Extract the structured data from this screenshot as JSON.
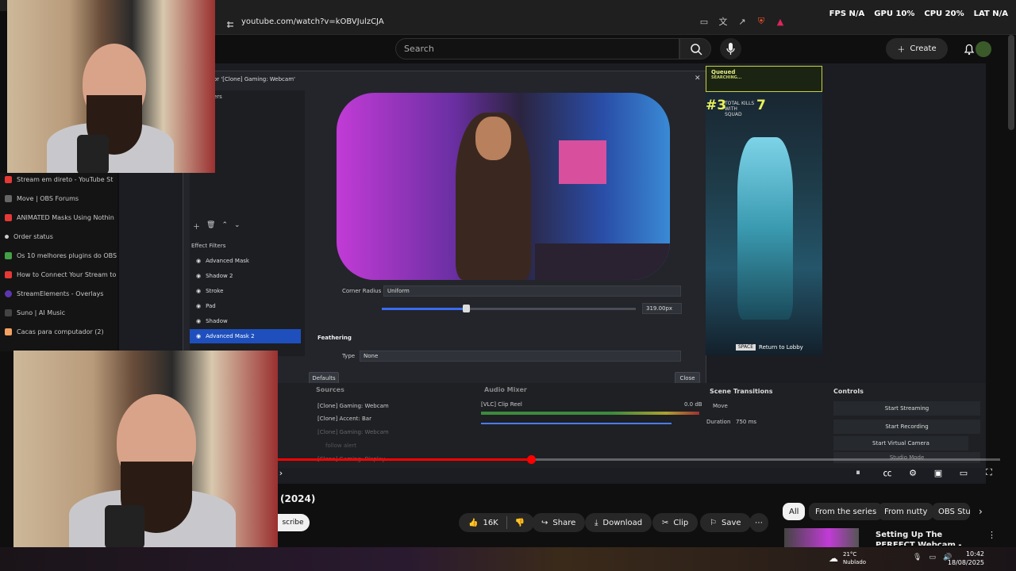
{
  "browser": {
    "url": "youtube.com/watch?v=kOBVJulzCJA",
    "hud": {
      "fps_label": "FPS",
      "fps": "N/A",
      "gpu_label": "GPU",
      "gpu": "10%",
      "cpu_label": "CPU",
      "cpu": "20%",
      "lat_label": "LAT",
      "lat": "N/A"
    }
  },
  "youtube": {
    "search_placeholder": "Search",
    "create_label": "Create",
    "video_title": "(2024)",
    "subscribe_label": "scribe",
    "actions": {
      "likes": "16K",
      "share": "Share",
      "download": "Download",
      "clip": "Clip",
      "save": "Save"
    },
    "chips": [
      "All",
      "From the series",
      "From nutty",
      "OBS Stu"
    ],
    "recommended_title": "Setting Up The PERFECT Webcam - Streaming"
  },
  "sidebar": {
    "items": [
      {
        "label": "Stream em direto - YouTube St",
        "color": "#e53935"
      },
      {
        "label": "Move | OBS Forums",
        "color": "#666666"
      },
      {
        "label": "ANIMATED Masks Using Nothin",
        "color": "#e53935"
      },
      {
        "label": "Order status",
        "color": "#cccccc"
      },
      {
        "label": "Os 10 melhores plugins do OBS",
        "color": "#43a047"
      },
      {
        "label": "How to Connect Your Stream to",
        "color": "#e53935"
      },
      {
        "label": "StreamElements - Overlays",
        "color": "#5e35b1"
      },
      {
        "label": "Suno | AI Music",
        "color": "#444444"
      },
      {
        "label": "Cacas para computador (2)",
        "color": "#f4a261"
      }
    ]
  },
  "obs": {
    "dialog_title": "or '[Clone] Gaming: Webcam'",
    "filters_header": "ers",
    "effect_filters_label": "Effect Filters",
    "filters": [
      "Advanced Mask",
      "Shadow 2",
      "Stroke",
      "Pad",
      "Shadow",
      "Advanced Mask 2"
    ],
    "selected_filter": "Advanced Mask 2",
    "corner_radius_label": "Corner Radius",
    "corner_radius_mode": "Uniform",
    "corner_radius_value": "319.00px",
    "feathering_label": "Feathering",
    "type_label": "Type",
    "type_value": "None",
    "defaults_label": "Defaults",
    "close_label": "Close",
    "slider_fraction": 0.33,
    "sources_header": "Sources",
    "sources": [
      "[Clone] Gaming: Webcam",
      "[Clone] Accent: Bar",
      "[Clone] Gaming: Webcam",
      "follow alert",
      "[Clone] Gaming: Display"
    ],
    "audio_header": "Audio Mixer",
    "audio_source": "[VLC] Clip Reel",
    "audio_db": "0.0 dB",
    "transitions_header": "Scene Transitions",
    "transition_value": "Move",
    "duration_label": "Duration",
    "duration_value": "750 ms",
    "controls_header": "Controls",
    "controls": [
      "Start Streaming",
      "Start Recording",
      "Start Virtual Camera",
      "Studio Mode"
    ]
  },
  "game": {
    "queued_label": "Queued",
    "queued_sub": "SEARCHING...",
    "rank": "#3",
    "kills_label": "TOTAL KILLS WITH SQUAD",
    "kills": "7",
    "space_key": "SPACE",
    "return_label": "Return to Lobby"
  },
  "player": {
    "progress_fraction": 0.35
  },
  "taskbar": {
    "temperature": "21°C",
    "weather": "Nublado",
    "time": "10:42",
    "date": "18/08/2025"
  }
}
